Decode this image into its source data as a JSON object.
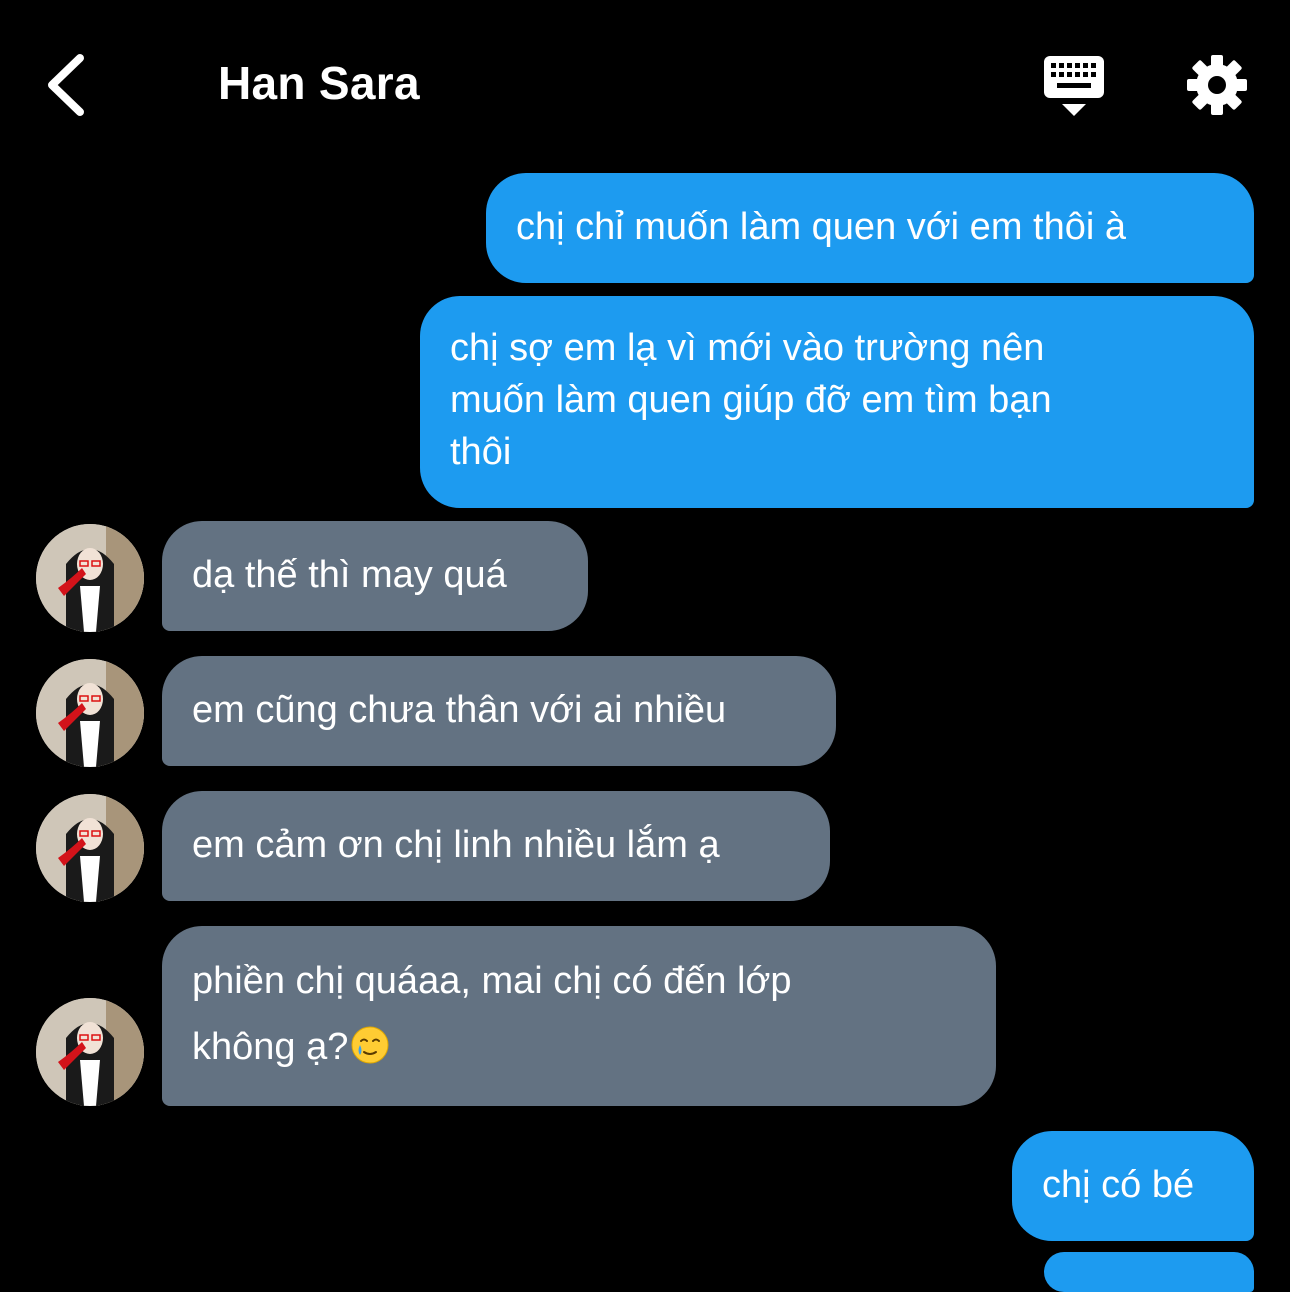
{
  "header": {
    "title": "Han Sara",
    "back_icon": "chevron-left-icon",
    "keyboard_icon": "keyboard-hide-icon",
    "settings_icon": "gear-icon"
  },
  "colors": {
    "background": "#000000",
    "sent_bubble": "#1d9bf0",
    "received_bubble": "#637282",
    "text": "#ffffff"
  },
  "messages": [
    {
      "from": "me",
      "text": "chị chỉ muốn làm quen với em thôi à"
    },
    {
      "from": "me",
      "text": "chị sợ em lạ vì mới vào trường nên\nmuốn làm quen giúp đỡ em tìm bạn\nthôi"
    },
    {
      "from": "them",
      "text": "dạ thế thì may quá"
    },
    {
      "from": "them",
      "text": "em cũng chưa thân với ai nhiều"
    },
    {
      "from": "them",
      "text": "em cảm ơn chị linh nhiều lắm ạ"
    },
    {
      "from": "them",
      "text": "phiền chị quáaa, mai chị có đến lớp\nkhông ạ?",
      "emoji": "teary-smile-emoji"
    },
    {
      "from": "me",
      "text": "chị có bé"
    }
  ]
}
